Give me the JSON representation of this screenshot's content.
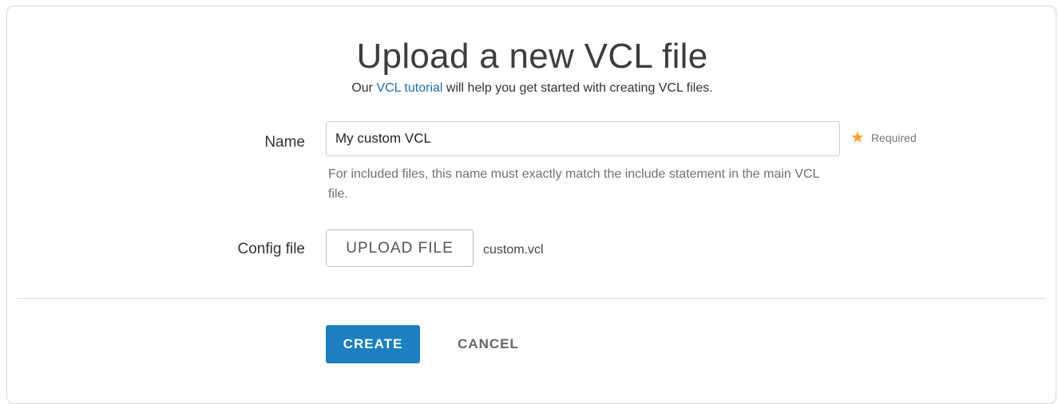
{
  "dialog": {
    "title": "Upload a new VCL file",
    "subtitle_prefix": "Our ",
    "subtitle_link": "VCL tutorial",
    "subtitle_suffix": " will help you get started with creating VCL files."
  },
  "form": {
    "name": {
      "label": "Name",
      "value": "My custom VCL",
      "required_star": "★",
      "required_text": "Required",
      "help": "For included files, this name must exactly match the include statement in the main VCL file."
    },
    "config_file": {
      "label": "Config file",
      "upload_label": "UPLOAD FILE",
      "filename": "custom.vcl"
    }
  },
  "actions": {
    "create_label": "CREATE",
    "cancel_label": "CANCEL"
  },
  "colors": {
    "primary": "#1b7fc2",
    "link": "#1d6fb8",
    "required_star": "#f5a233"
  }
}
